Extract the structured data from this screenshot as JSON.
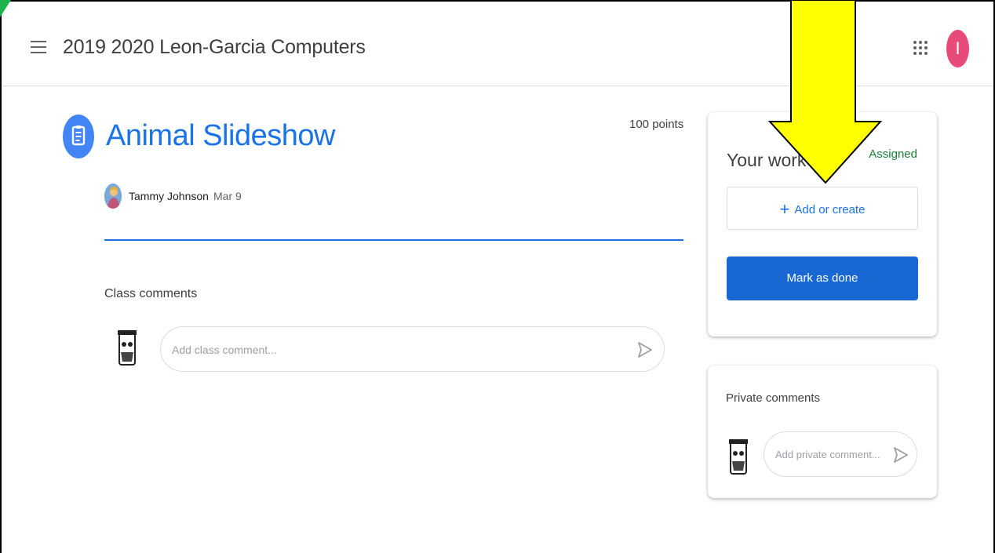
{
  "header": {
    "class_title": "2019 2020 Leon-Garcia Computers",
    "menu_icon": "hamburger-menu-icon",
    "apps_icon": "apps-grid-icon",
    "account_initial": "I",
    "account_color": "#e84b7a"
  },
  "assignment": {
    "icon": "assignment-icon",
    "title": "Animal Slideshow",
    "points": "100 points",
    "author": "Tammy Johnson",
    "date": "Mar 9"
  },
  "class_comments": {
    "label": "Class comments",
    "placeholder": "Add class comment..."
  },
  "your_work": {
    "title": "Your work",
    "status": "Assigned",
    "add_label": "Add or create",
    "mark_done_label": "Mark as done"
  },
  "private_comments": {
    "label": "Private comments",
    "placeholder": "Add private comment..."
  },
  "colors": {
    "accent": "#1a73e8",
    "assigned": "#188038",
    "highlight_arrow": "#ffff00"
  }
}
